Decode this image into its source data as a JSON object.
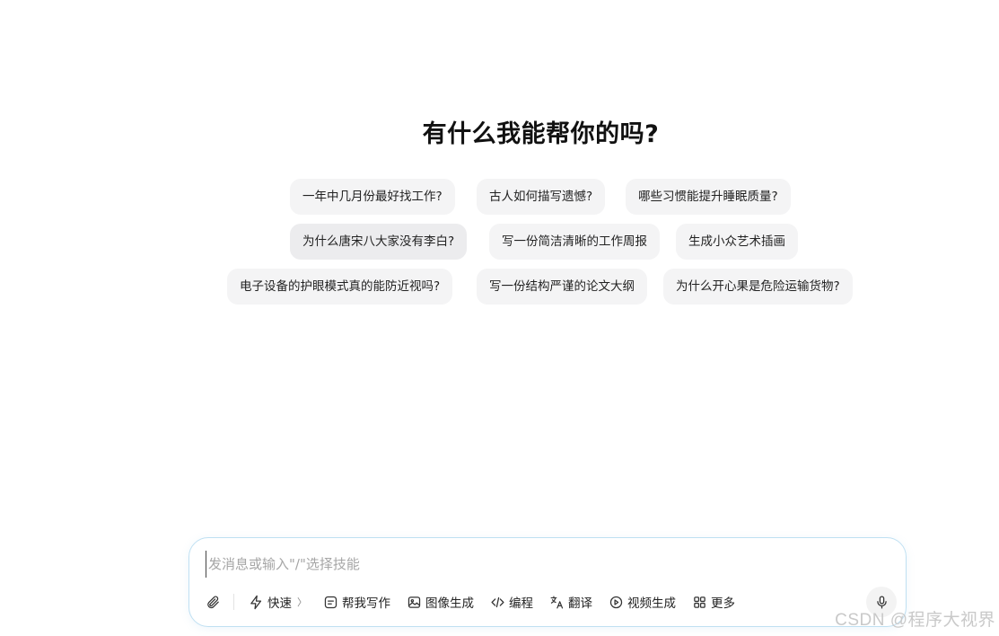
{
  "title": "有什么我能帮你的吗?",
  "suggestions": [
    "一年中几月份最好找工作?",
    "古人如何描写遗憾?",
    "哪些习惯能提升睡眠质量?",
    "为什么唐宋八大家没有李白?",
    "写一份简洁清晰的工作周报",
    "生成小众艺术插画",
    "电子设备的护眼模式真的能防近视吗?",
    "写一份结构严谨的论文大纲",
    "为什么开心果是危险运输货物?"
  ],
  "composer": {
    "placeholder": "发消息或输入\"/\"选择技能",
    "tools": {
      "fast": "快速",
      "fast_chevron": "〉",
      "writing": "帮我写作",
      "image": "图像生成",
      "code": "编程",
      "translate": "翻译",
      "video": "视频生成",
      "more": "更多"
    }
  },
  "icons": {
    "attach": "paperclip-icon",
    "fast": "lightning-icon",
    "writing": "pen-box-icon",
    "image": "image-icon",
    "code": "code-icon",
    "translate": "translate-icon",
    "video": "play-icon",
    "more": "grid-icon",
    "mic": "microphone-icon"
  },
  "watermark": "CSDN @程序大视界"
}
